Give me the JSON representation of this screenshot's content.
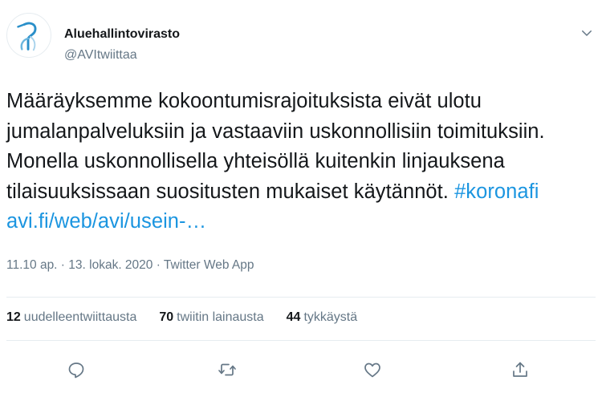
{
  "author": {
    "display_name": "Aluehallintovirasto",
    "handle": "@AVItwiittaa"
  },
  "tweet": {
    "text_plain": "Määräyksemme kokoontumisrajoituksista eivät ulotu jumalanpalveluksiin ja vastaaviin uskonnollisiin toimituksiin. Monella uskonnollisella yhteisöllä kuitenkin linjauksena tilaisuuksissaan suositusten mukaiset käytännöt. ",
    "hashtag": "#koronafi",
    "link": "avi.fi/web/avi/usein-…"
  },
  "meta": {
    "time": "11.10 ap.",
    "separator": " · ",
    "date": "13. lokak. 2020",
    "source": "Twitter Web App"
  },
  "stats": {
    "retweets_count": "12",
    "retweets_label": "uudelleentwiittausta",
    "quotes_count": "70",
    "quotes_label": "twiitin lainausta",
    "likes_count": "44",
    "likes_label": "tykkäystä"
  },
  "icons": {
    "caret": "chevron-down-icon",
    "reply": "reply-icon",
    "retweet": "retweet-icon",
    "like": "heart-icon",
    "share": "share-icon"
  },
  "colors": {
    "link": "#1b95e0",
    "text": "#14171a",
    "muted": "#657786",
    "divider": "#e6ecf0"
  }
}
